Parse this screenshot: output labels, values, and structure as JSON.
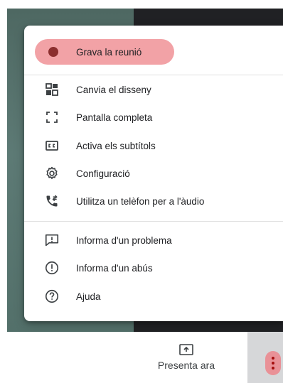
{
  "menu": {
    "items": [
      {
        "label": "Grava la reunió",
        "icon": "record-icon"
      },
      {
        "label": "Canvia el disseny",
        "icon": "layout-icon"
      },
      {
        "label": "Pantalla completa",
        "icon": "fullscreen-icon"
      },
      {
        "label": "Activa els subtítols",
        "icon": "captions-icon"
      },
      {
        "label": "Configuració",
        "icon": "settings-gear-icon"
      },
      {
        "label": "Utilitza un telèfon per a l'àudio",
        "icon": "phone-audio-icon"
      },
      {
        "label": "Informa d'un problema",
        "icon": "feedback-icon"
      },
      {
        "label": "Informa d'un abús",
        "icon": "report-abuse-icon"
      },
      {
        "label": "Ajuda",
        "icon": "help-icon"
      }
    ]
  },
  "toolbar": {
    "present_label": "Presenta ara"
  },
  "colors": {
    "record_highlight": "#f2a2a6",
    "record_dot": "#8b2e2e",
    "more_button": "#e99197"
  }
}
